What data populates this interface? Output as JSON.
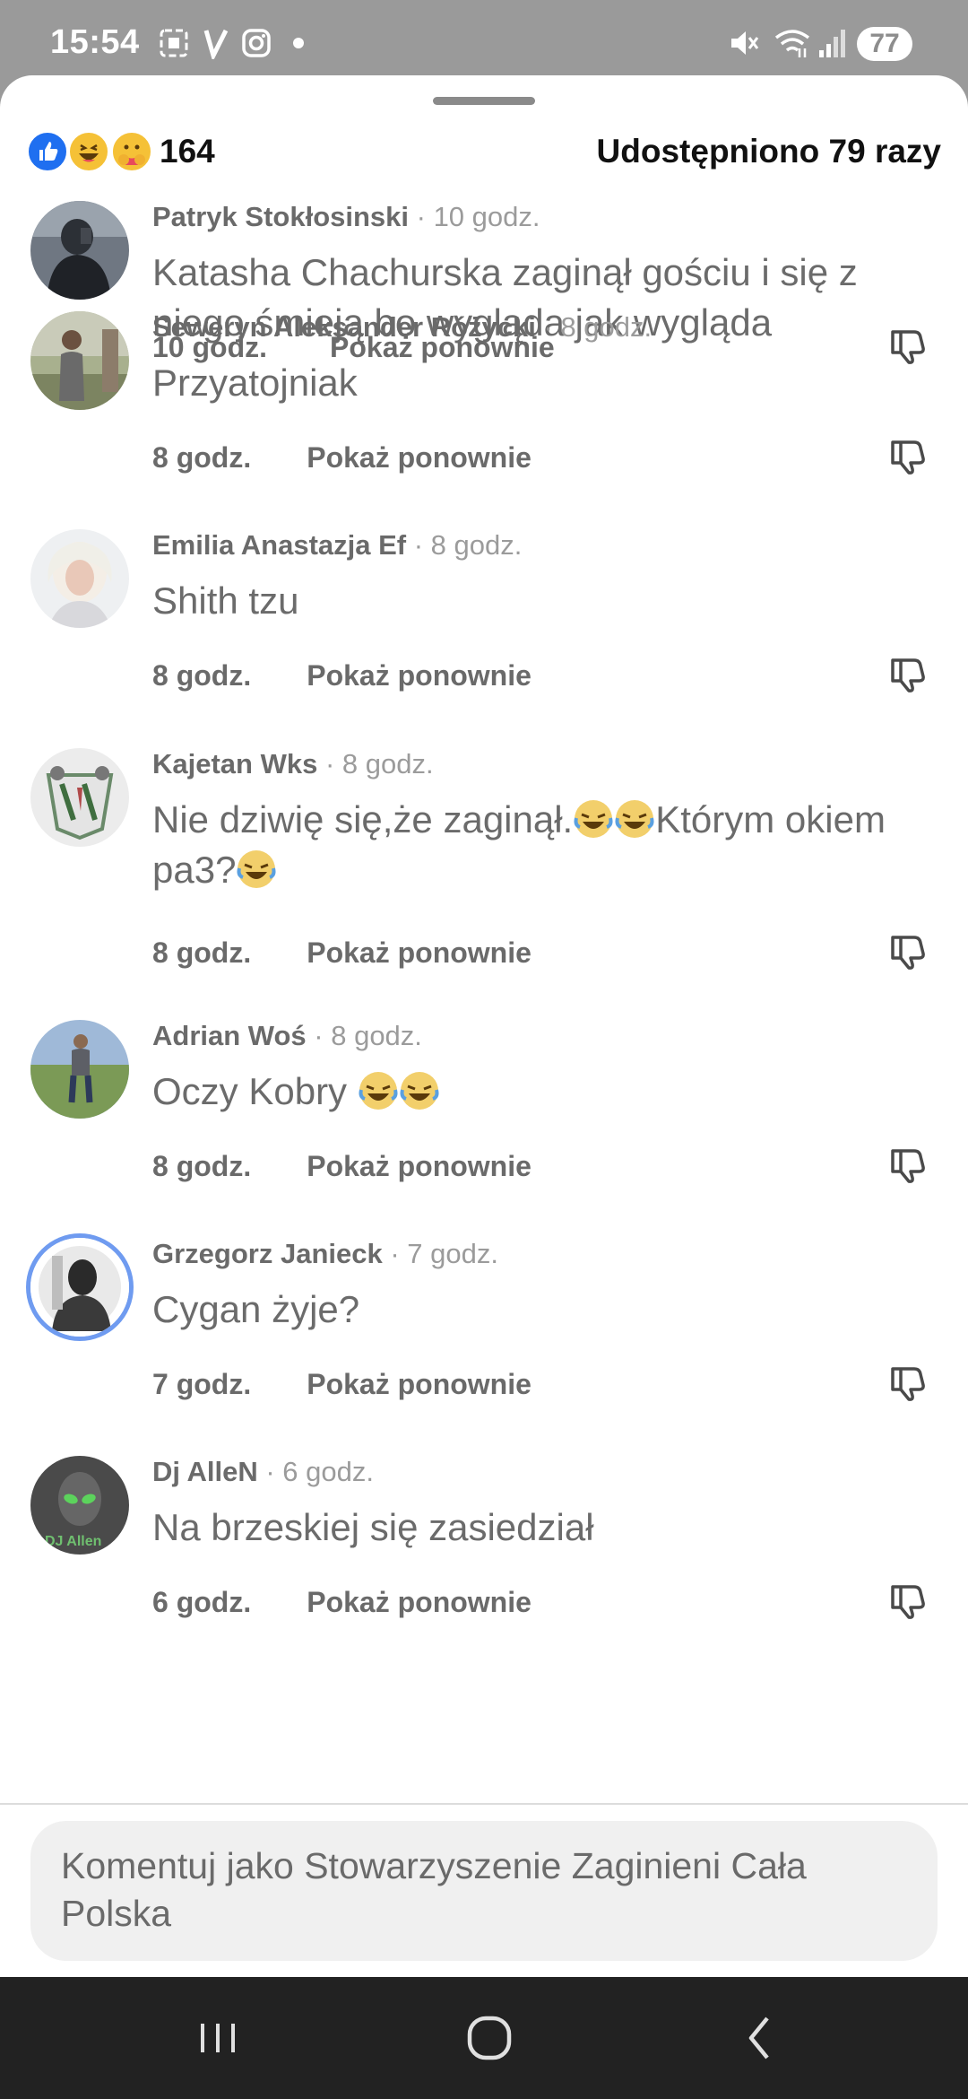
{
  "status_bar": {
    "time": "15:54",
    "battery": "77",
    "icons": [
      "screenshot-icon",
      "v-app-icon",
      "instagram-icon",
      "dot-icon",
      "mute-icon",
      "wifi-icon",
      "signal-icon"
    ]
  },
  "post": {
    "reaction_count": "164",
    "shares_label": "Udostępniono 79 razy",
    "reaction_icons": [
      "like-icon",
      "haha-icon",
      "care-icon"
    ]
  },
  "comments": [
    {
      "name": "Patryk Stokłosinski",
      "age": " · 10 godz.",
      "text": "Katasha Chachurska zaginął gościu i się z niego śmieją bo wygląda jak wygląda",
      "time": "10 godz.",
      "show_again": "Pokaż ponownie"
    },
    {
      "name": "Seweryn Aleksander Różycki",
      "age": " · 8 godz.",
      "text": "Przyatojniak",
      "time": "8 godz.",
      "show_again": "Pokaż ponownie"
    },
    {
      "name": "Emilia Anastazja Ef",
      "age": " · 8 godz.",
      "text": "Shith tzu",
      "time": "8 godz.",
      "show_again": "Pokaż ponownie"
    },
    {
      "name": "Kajetan Wks",
      "age": " · 8 godz.",
      "text_part1": "Nie dziwię się,że zaginął.",
      "text_part2": "Którym okiem pa3?",
      "time": "8 godz.",
      "show_again": "Pokaż ponownie"
    },
    {
      "name": "Adrian Woś",
      "age": " · 8 godz.",
      "text": "Oczy Kobry ",
      "time": "8 godz.",
      "show_again": "Pokaż ponownie"
    },
    {
      "name": "Grzegorz Janieck",
      "age": " · 7 godz.",
      "text": "Cygan żyje?",
      "time": "7 godz.",
      "show_again": "Pokaż ponownie"
    },
    {
      "name": "Dj AlleN",
      "age": " · 6 godz.",
      "text": "Na brzeskiej się zasiedział",
      "time": "6 godz.",
      "show_again": "Pokaż ponownie"
    }
  ],
  "composer": {
    "placeholder": "Komentuj jako Stowarzyszenie Zaginieni Cała Polska"
  },
  "avatar_texts": {
    "dj": "DJ Allen"
  }
}
